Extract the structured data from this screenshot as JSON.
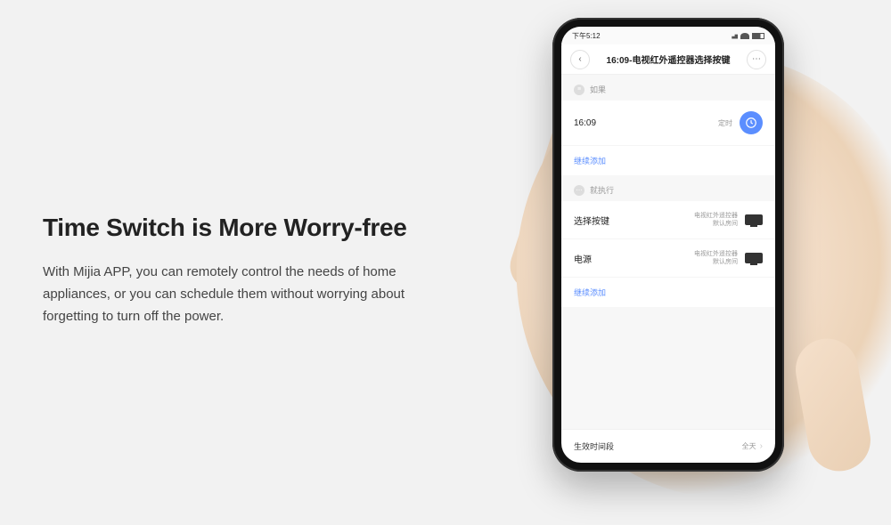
{
  "marketing": {
    "headline": "Time Switch is More Worry-free",
    "description": "With Mijia APP, you can remotely control the needs of home appliances, or you can schedule them without worrying about forgetting to turn off the power."
  },
  "phone": {
    "status_time": "下午5:12",
    "header_title": "16:09-电视红外遥控器选择按键",
    "section_if": "如果",
    "condition_time": "16:09",
    "condition_type": "定时",
    "add_more": "继续添加",
    "section_then": "就执行",
    "actions": [
      {
        "label": "选择按键",
        "device": "电视红外遥控器",
        "room": "默认房间"
      },
      {
        "label": "电源",
        "device": "电视红外遥控器",
        "room": "默认房间"
      }
    ],
    "footer_label": "生效时间段",
    "footer_value": "全天"
  }
}
